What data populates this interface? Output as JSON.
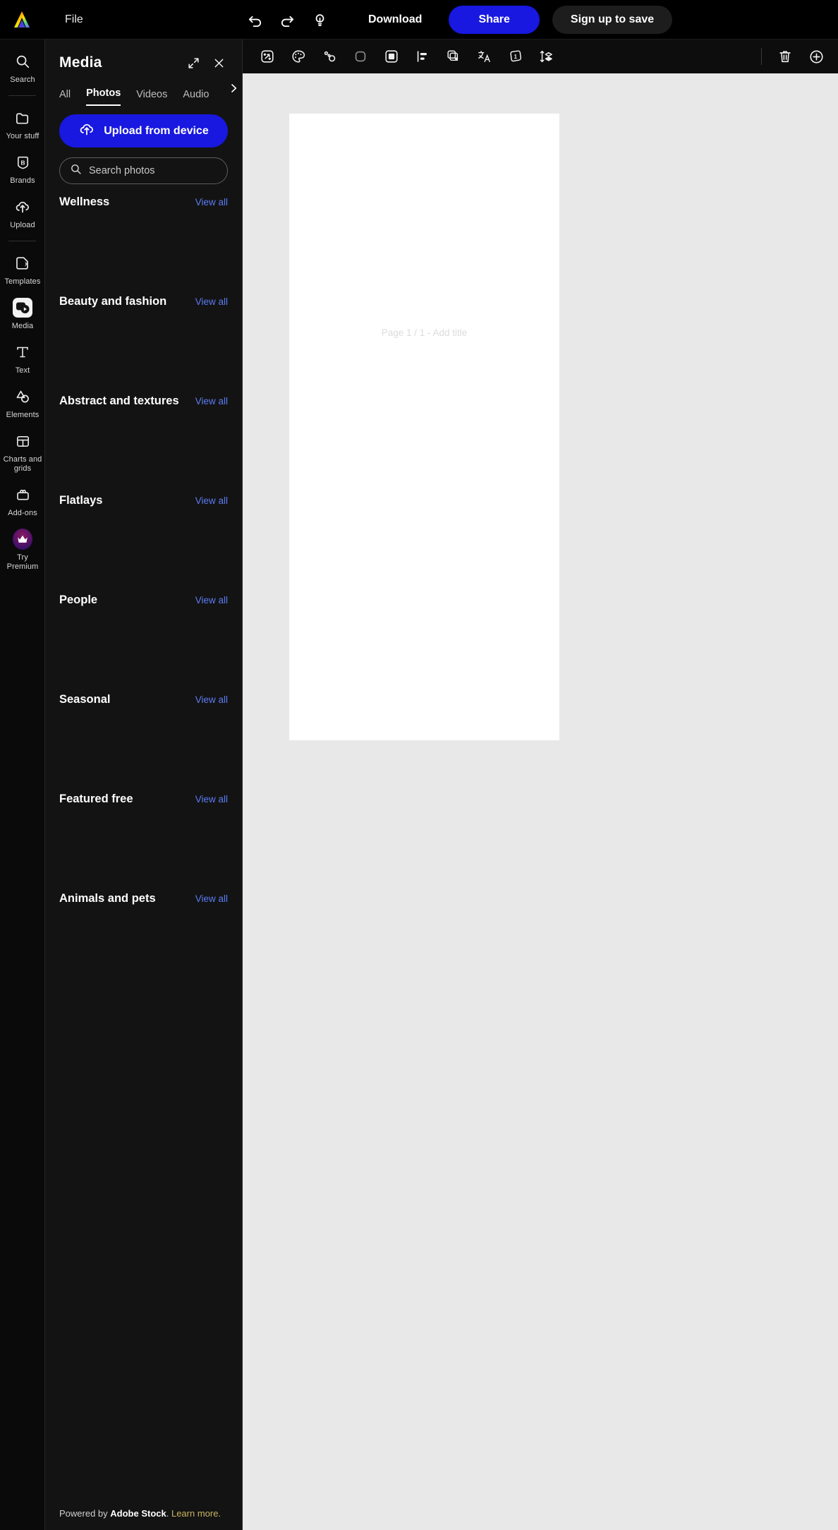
{
  "topbar": {
    "logo_icon": "adobe-express-logo",
    "file_label": "File",
    "undo_icon": "undo-icon",
    "redo_icon": "redo-icon",
    "ideas_icon": "lightbulb-icon",
    "download_label": "Download",
    "share_label": "Share",
    "signup_label": "Sign up to save",
    "share_color": "#1818e0"
  },
  "rail": {
    "items": [
      {
        "label": "Search",
        "icon": "search-icon",
        "name": "search",
        "active": false
      },
      {
        "label": "Your stuff",
        "icon": "folder-icon",
        "name": "your-stuff",
        "active": false
      },
      {
        "label": "Brands",
        "icon": "brands-shield-icon",
        "name": "brands",
        "active": false
      },
      {
        "label": "Upload",
        "icon": "cloud-upload-icon",
        "name": "upload",
        "active": false
      },
      {
        "label": "Templates",
        "icon": "templates-icon",
        "name": "templates",
        "active": false
      },
      {
        "label": "Media",
        "icon": "media-icon",
        "name": "media",
        "active": true
      },
      {
        "label": "Text",
        "icon": "text-t-icon",
        "name": "text",
        "active": false
      },
      {
        "label": "Elements",
        "icon": "elements-shapes-icon",
        "name": "elements",
        "active": false
      },
      {
        "label": "Charts and grids",
        "icon": "charts-grids-icon",
        "name": "charts-and-grids",
        "active": false
      },
      {
        "label": "Add-ons",
        "icon": "add-ons-icon",
        "name": "add-ons",
        "active": false
      },
      {
        "label": "Try Premium",
        "icon": "crown-icon",
        "name": "try-premium",
        "active": false
      }
    ]
  },
  "panel": {
    "title": "Media",
    "expand_icon": "expand-diagonal-icon",
    "close_icon": "close-x-icon",
    "tabs": [
      {
        "label": "All",
        "active": false
      },
      {
        "label": "Photos",
        "active": true
      },
      {
        "label": "Videos",
        "active": false
      },
      {
        "label": "Audio",
        "active": false
      }
    ],
    "tab_scroll_icon": "chevron-right-icon",
    "upload_label": "Upload from device",
    "upload_icon": "cloud-upload-icon",
    "search": {
      "placeholder": "Search photos",
      "value": "",
      "icon": "search-icon"
    },
    "view_all_label": "View all",
    "categories": [
      {
        "title": "Wellness"
      },
      {
        "title": "Beauty and fashion"
      },
      {
        "title": "Abstract and textures"
      },
      {
        "title": "Flatlays"
      },
      {
        "title": "People"
      },
      {
        "title": "Seasonal"
      },
      {
        "title": "Featured free"
      },
      {
        "title": "Animals and pets"
      }
    ],
    "footer": {
      "prefix": "Powered by ",
      "brand": "Adobe Stock",
      "middle": ". ",
      "link": "Learn more."
    }
  },
  "canvas_toolbar": {
    "buttons": [
      {
        "name": "resize-magic-icon",
        "title": "Resize"
      },
      {
        "name": "color-palette-icon",
        "title": "Color palette"
      },
      {
        "name": "animate-icon",
        "title": "Animate"
      },
      {
        "name": "rounded-square-icon",
        "title": "Shape"
      },
      {
        "name": "frame-icon",
        "title": "Frame"
      },
      {
        "name": "align-icon",
        "title": "Align"
      },
      {
        "name": "duplicate-layers-icon",
        "title": "Duplicate"
      },
      {
        "name": "translate-icon",
        "title": "Translate"
      },
      {
        "name": "page-number-icon",
        "title": "Page"
      },
      {
        "name": "arrange-layers-icon",
        "title": "Arrange"
      }
    ],
    "right_buttons": [
      {
        "name": "trash-icon",
        "title": "Delete"
      },
      {
        "name": "add-page-icon",
        "title": "Add page"
      }
    ]
  },
  "canvas": {
    "page_label": "Page 1 / 1 - Add title",
    "background_color": "#e8e8e8",
    "page_color": "#ffffff"
  }
}
